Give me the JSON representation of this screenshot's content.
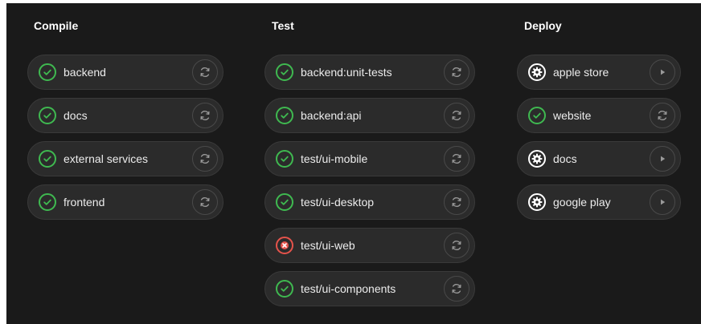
{
  "colors": {
    "background": "#1a1a1a",
    "job_background": "#2b2b2b",
    "success": "#3fb950",
    "failed": "#e5534b",
    "manual": "#ffffff",
    "text": "#ececec"
  },
  "stages": [
    {
      "title": "Compile",
      "jobs": [
        {
          "name": "backend",
          "status": "success",
          "action": "retry"
        },
        {
          "name": "docs",
          "status": "success",
          "action": "retry"
        },
        {
          "name": "external services",
          "status": "success",
          "action": "retry"
        },
        {
          "name": "frontend",
          "status": "success",
          "action": "retry"
        }
      ]
    },
    {
      "title": "Test",
      "jobs": [
        {
          "name": "backend:unit-tests",
          "status": "success",
          "action": "retry"
        },
        {
          "name": "backend:api",
          "status": "success",
          "action": "retry"
        },
        {
          "name": "test/ui-mobile",
          "status": "success",
          "action": "retry"
        },
        {
          "name": "test/ui-desktop",
          "status": "success",
          "action": "retry"
        },
        {
          "name": "test/ui-web",
          "status": "failed",
          "action": "retry"
        },
        {
          "name": "test/ui-components",
          "status": "success",
          "action": "retry"
        }
      ]
    },
    {
      "title": "Deploy",
      "jobs": [
        {
          "name": "apple store",
          "status": "manual",
          "action": "play"
        },
        {
          "name": "website",
          "status": "success",
          "action": "retry"
        },
        {
          "name": "docs",
          "status": "manual",
          "action": "play"
        },
        {
          "name": "google play",
          "status": "manual",
          "action": "play"
        }
      ]
    }
  ]
}
